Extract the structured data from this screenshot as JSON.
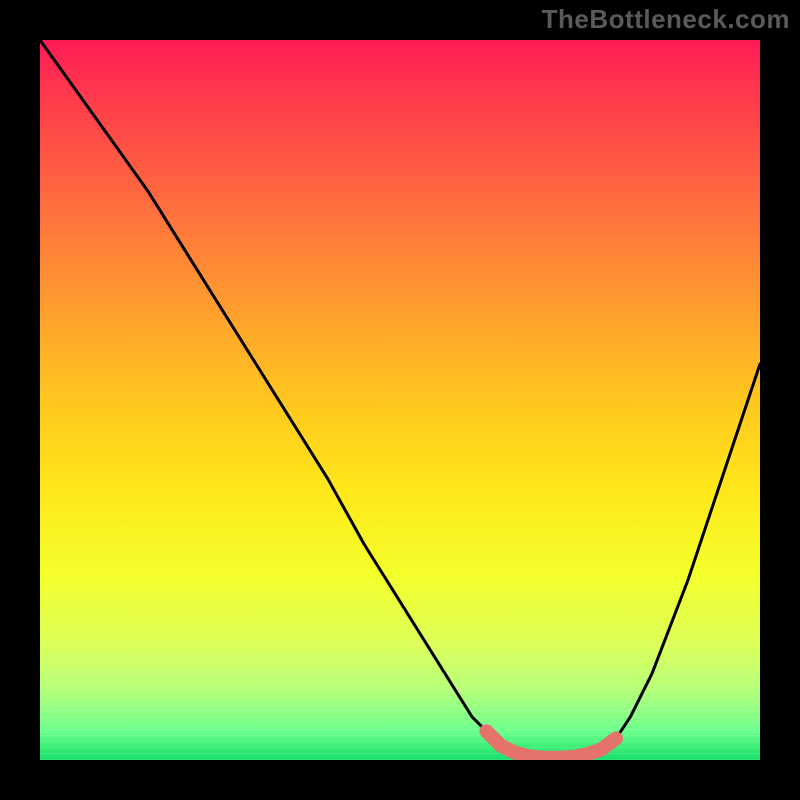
{
  "watermark": "TheBottleneck.com",
  "chart_data": {
    "type": "line",
    "title": "",
    "xlabel": "",
    "ylabel": "",
    "xlim": [
      0,
      100
    ],
    "ylim": [
      0,
      100
    ],
    "grid": false,
    "series": [
      {
        "name": "curve",
        "x": [
          0,
          5,
          10,
          15,
          20,
          25,
          30,
          35,
          40,
          45,
          50,
          55,
          60,
          62,
          64,
          66,
          68,
          70,
          72,
          74,
          76,
          78,
          80,
          82,
          85,
          90,
          95,
          100
        ],
        "y": [
          100,
          93,
          86,
          79,
          71,
          63,
          55,
          47,
          39,
          30,
          22,
          14,
          6,
          4,
          2,
          1,
          0.5,
          0.3,
          0.3,
          0.4,
          0.8,
          1.5,
          3,
          6,
          12,
          25,
          40,
          55
        ]
      }
    ],
    "annotations": [
      {
        "name": "bottom-segment",
        "style": "thick-red",
        "x_range": [
          62,
          80
        ]
      }
    ],
    "background_gradient": {
      "stops": [
        {
          "pos": 0,
          "color": "#ff1a56"
        },
        {
          "pos": 50,
          "color": "#ffc61f"
        },
        {
          "pos": 100,
          "color": "#15e06a"
        }
      ]
    }
  }
}
